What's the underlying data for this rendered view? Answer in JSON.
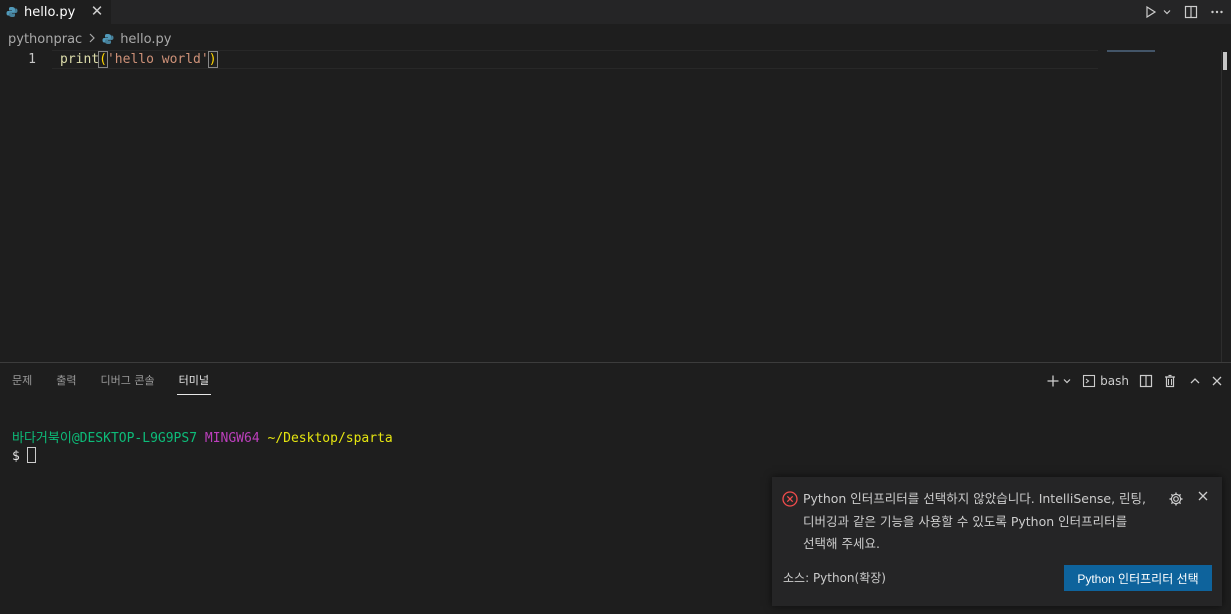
{
  "tab": {
    "title": "hello.py",
    "close_glyph": "✕"
  },
  "breadcrumb": {
    "folder": "pythonprac",
    "file": "hello.py"
  },
  "editor": {
    "line_number": "1",
    "code": {
      "fn": "print",
      "open": "(",
      "str": "'hello world'",
      "close": ")"
    }
  },
  "panel": {
    "tabs": [
      "문제",
      "출력",
      "디버그 콘솔",
      "터미널"
    ],
    "active_tab": "터미널",
    "shell_label": "bash"
  },
  "terminal": {
    "user": "바다거북이",
    "host": "@DESKTOP-L9G9PS7",
    "system": "MINGW64",
    "path": "~/Desktop/sparta",
    "prompt": "$"
  },
  "notification": {
    "line1": "Python 인터프리터를 선택하지 않았습니다. IntelliSense, 린팅,",
    "line2": "디버깅과 같은 기능을 사용할 수 있도록 Python 인터프리터를",
    "line3": "선택해 주세요.",
    "source": "소스: Python(확장)",
    "button": "Python 인터프리터 선택"
  },
  "colors": {
    "accent_button": "#0e639c",
    "error": "#f14c4c",
    "python_icon": "#519aba"
  }
}
